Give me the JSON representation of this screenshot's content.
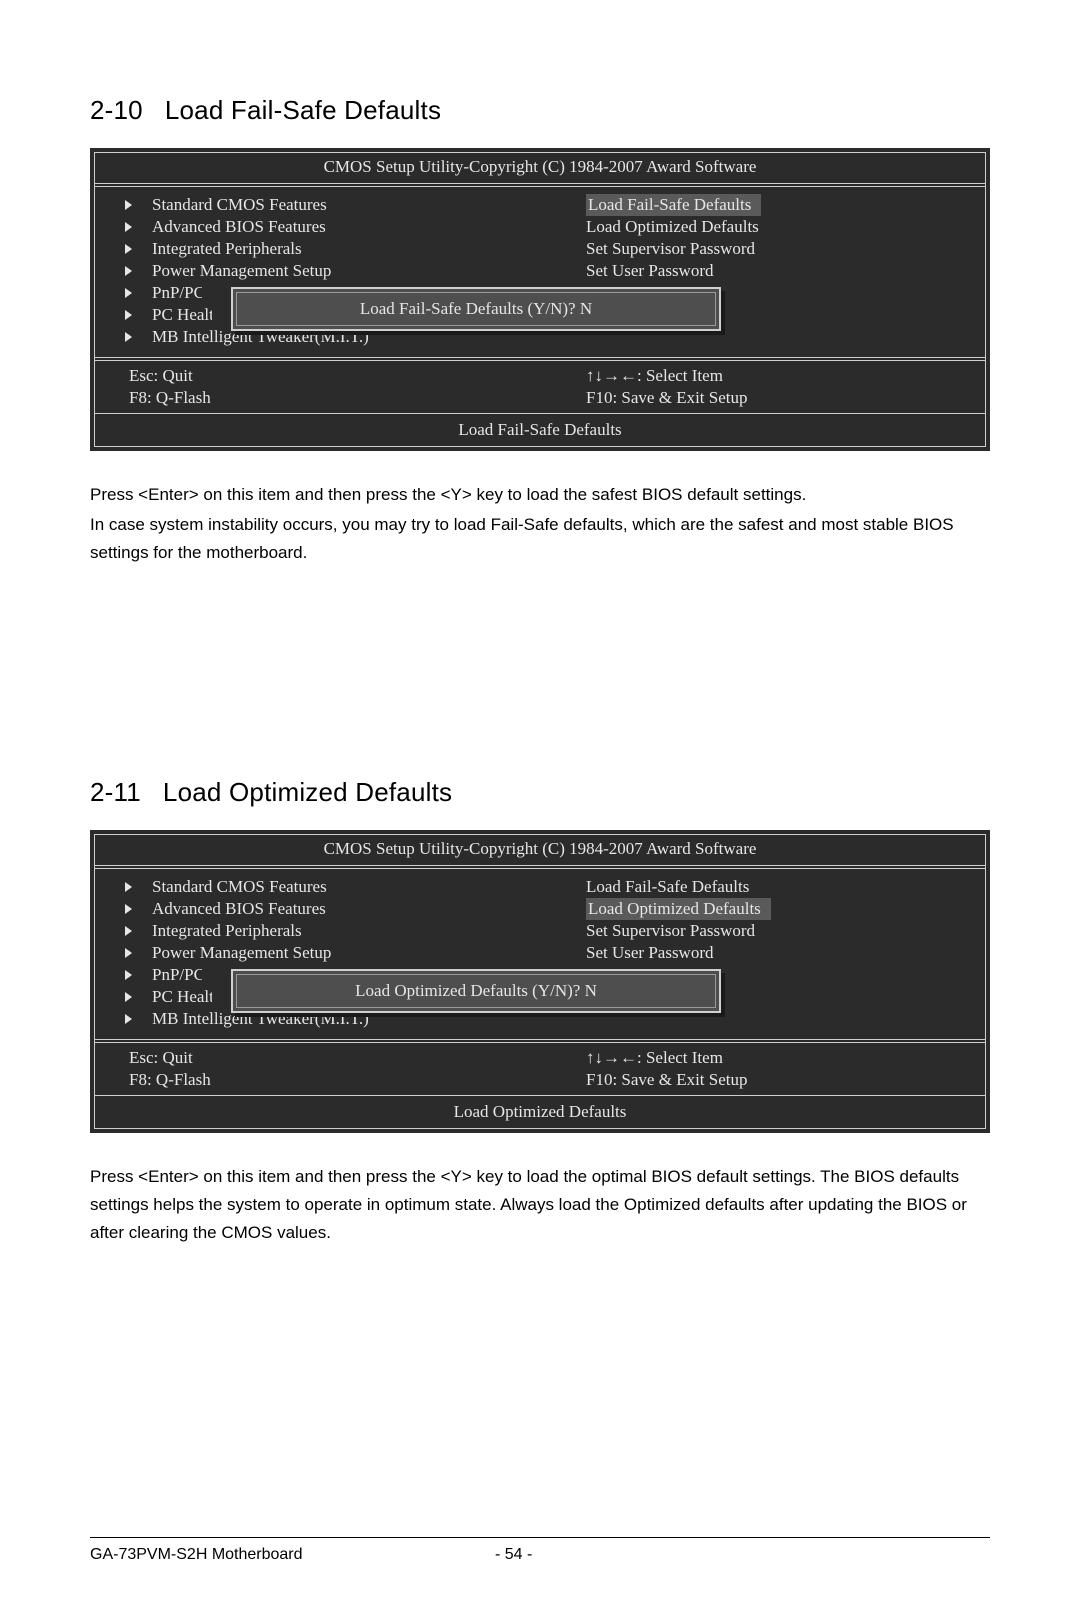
{
  "section1": {
    "num": "2-10",
    "title": "Load Fail-Safe Defaults",
    "bios": {
      "title": "CMOS Setup Utility-Copyright (C) 1984-2007 Award Software",
      "left_items": [
        "Standard CMOS Features",
        "Advanced BIOS Features",
        "Integrated Peripherals",
        "Power Management Setup",
        "PnP/PCI Configurations",
        "PC Health Status",
        "MB Intelligent Tweaker(M.I.T.)"
      ],
      "right_items": [
        "Load Fail-Safe Defaults",
        "Load Optimized Defaults",
        "Set Supervisor Password",
        "Set User Password"
      ],
      "highlighted_right_index": 0,
      "dialog": "Load Fail-Safe Defaults (Y/N)? N",
      "hints": {
        "esc": "Esc: Quit",
        "f8": "F8: Q-Flash",
        "arrows": "↑↓→←: Select Item",
        "f10": "F10: Save & Exit Setup"
      },
      "footer": "Load Fail-Safe Defaults"
    },
    "paragraphs": [
      "Press <Enter> on this item and then press the <Y> key to load the safest BIOS default settings.",
      "In case system instability occurs, you may try to load Fail-Safe defaults, which are the safest and most stable BIOS settings for the motherboard."
    ]
  },
  "section2": {
    "num": "2-11",
    "title": "Load Optimized Defaults",
    "bios": {
      "title": "CMOS Setup Utility-Copyright (C) 1984-2007 Award Software",
      "left_items": [
        "Standard CMOS Features",
        "Advanced BIOS Features",
        "Integrated Peripherals",
        "Power Management Setup",
        "PnP/PCI Configurations",
        "PC Health Status",
        "MB Intelligent Tweaker(M.I.T.)"
      ],
      "right_items": [
        "Load Fail-Safe Defaults",
        "Load Optimized Defaults",
        "Set Supervisor Password",
        "Set User Password"
      ],
      "highlighted_right_index": 1,
      "dialog": "Load Optimized Defaults (Y/N)? N",
      "hints": {
        "esc": "Esc: Quit",
        "f8": "F8: Q-Flash",
        "arrows": "↑↓→←: Select Item",
        "f10": "F10: Save & Exit Setup"
      },
      "footer": "Load Optimized Defaults"
    },
    "paragraphs": [
      "Press <Enter> on this item and then press the <Y> key to load the optimal BIOS default settings. The BIOS defaults settings helps the system to operate in optimum state. Always load the Optimized defaults after updating the BIOS or after clearing the CMOS values."
    ]
  },
  "footer": {
    "model": "GA-73PVM-S2H Motherboard",
    "page": "- 54 -"
  }
}
